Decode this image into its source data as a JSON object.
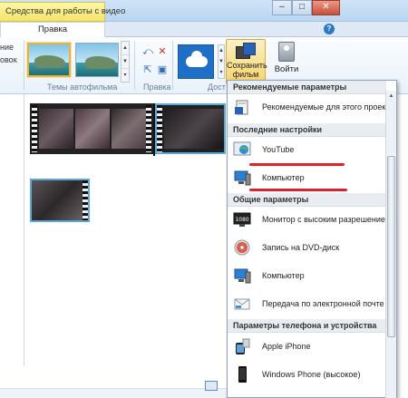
{
  "titlebar": {
    "context_tab": "Средства для работы с видео",
    "minimize": "–",
    "maximize": "□",
    "close": "✕"
  },
  "tabs": {
    "edit": "Правка",
    "help": "?"
  },
  "ribbon": {
    "left_labels": [
      "ние",
      "овок"
    ],
    "groups": {
      "themes": "Темы автофильма",
      "edit": "Правка",
      "share": "Дост"
    },
    "save_movie": "Сохранить фильм",
    "save_movie_arrow": "▾",
    "sign_in": "Войти"
  },
  "menu": {
    "sections": [
      {
        "header": "Рекомендуемые параметры",
        "items": [
          {
            "label": "Рекомендуемые для этого проекта",
            "icon": "recommended-settings-icon"
          }
        ]
      },
      {
        "header": "Последние настройки",
        "items": [
          {
            "label": "YouTube",
            "icon": "globe-icon"
          },
          {
            "label": "Компьютер",
            "icon": "computer-icon"
          }
        ]
      },
      {
        "header": "Общие параметры",
        "items": [
          {
            "label": "Монитор с высоким разрешением",
            "icon": "hd-monitor-icon"
          },
          {
            "label": "Запись на DVD-диск",
            "icon": "dvd-icon"
          },
          {
            "label": "Компьютер",
            "icon": "computer-icon"
          },
          {
            "label": "Передача по электронной почте",
            "icon": "email-icon"
          }
        ]
      },
      {
        "header": "Параметры телефона и устройства",
        "items": [
          {
            "label": "Apple iPhone",
            "icon": "iphone-icon"
          },
          {
            "label": "Windows Phone (высокое)",
            "icon": "windows-phone-icon"
          }
        ]
      }
    ]
  },
  "colors": {
    "highlight_mark": "#e0202a",
    "selection_border": "#5aa9d8",
    "save_button": "#f6d46a"
  }
}
